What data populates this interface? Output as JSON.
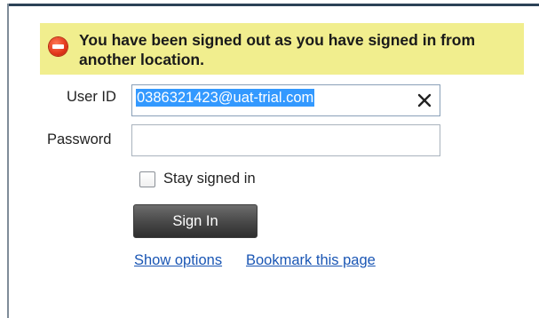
{
  "banner": {
    "message": "You have been signed out as you have signed in from another location.",
    "icon": "error-minus-icon",
    "background": "#f1ee8e"
  },
  "form": {
    "user_id_label": "User ID",
    "user_id_value": "0386321423@uat-trial.com",
    "password_label": "Password",
    "password_value": "",
    "stay_signed_in_label": "Stay signed in",
    "stay_signed_in_checked": false,
    "sign_in_label": "Sign In"
  },
  "links": {
    "show_options": "Show options",
    "bookmark": "Bookmark this page"
  },
  "colors": {
    "link": "#1a56b4",
    "selection": "#3399ff",
    "button": "#4a4a4a"
  }
}
